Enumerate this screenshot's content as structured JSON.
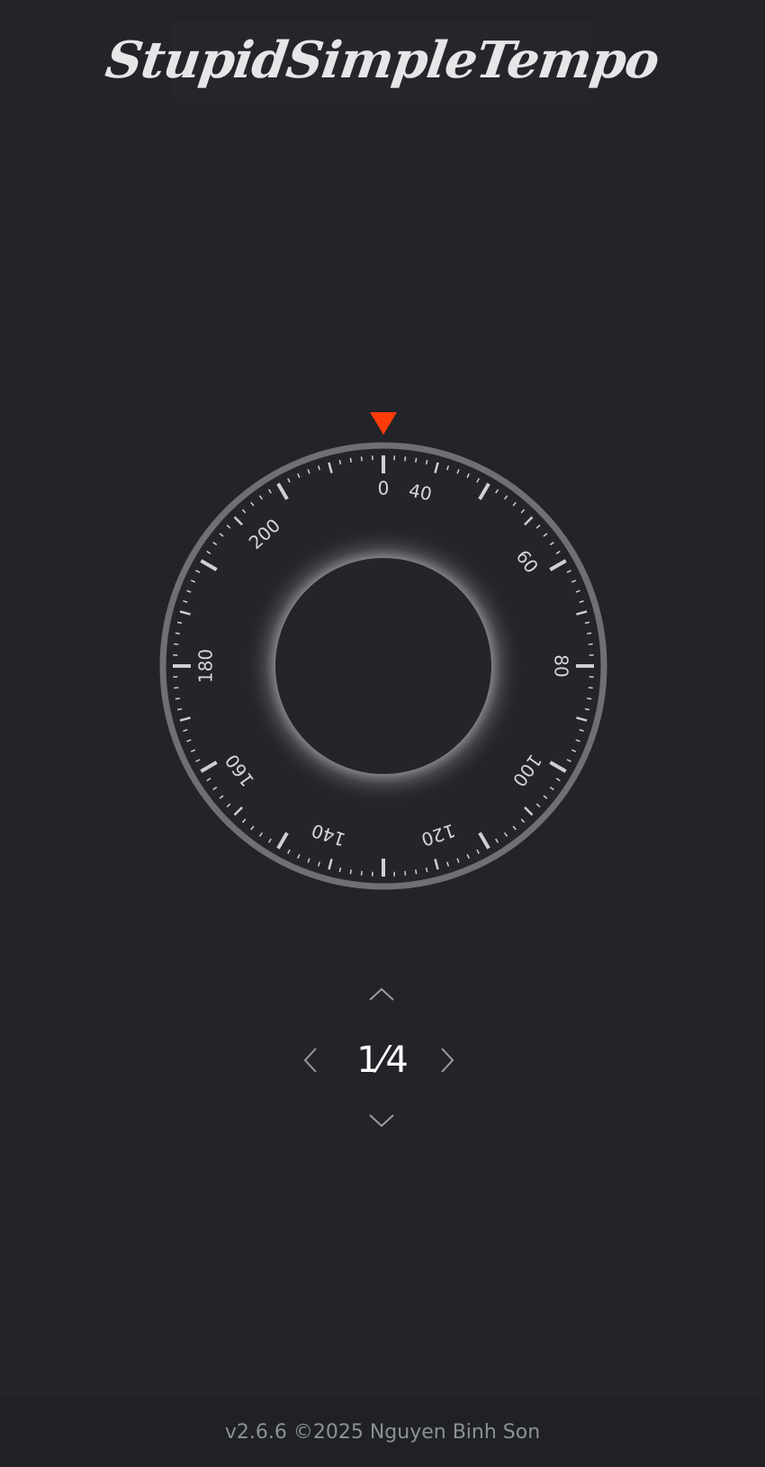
{
  "app": {
    "logo_text": "StupidSimpleTempo"
  },
  "dial": {
    "labels": [
      {
        "text": "0",
        "deg": 0
      },
      {
        "text": "40",
        "deg": 12
      },
      {
        "text": "60",
        "deg": 54
      },
      {
        "text": "80",
        "deg": 90
      },
      {
        "text": "100",
        "deg": 126
      },
      {
        "text": "120",
        "deg": 162
      },
      {
        "text": "140",
        "deg": 198
      },
      {
        "text": "160",
        "deg": 234
      },
      {
        "text": "180",
        "deg": 270
      },
      {
        "text": "200",
        "deg": 318
      }
    ],
    "indicator_color": "#ff3b0a",
    "ring_color": "#6e7075",
    "tick_color": "#d0d0d2",
    "glow_color": "#ffffff"
  },
  "beat": {
    "value": "1⁄4",
    "icons": {
      "up": "chevron-up-icon",
      "down": "chevron-down-icon",
      "left": "chevron-left-icon",
      "right": "chevron-right-icon"
    }
  },
  "footer": {
    "text": "v2.6.6 ©2025 Nguyen Binh Son"
  }
}
